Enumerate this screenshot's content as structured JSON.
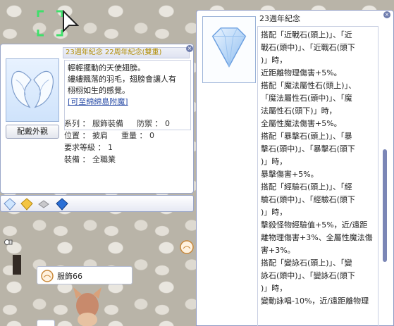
{
  "left_window": {
    "title": "23週年紀念 22周年紀念(雙重)",
    "description": [
      "輕輕擺動的天使翅膀。",
      "縷縷飄落的羽毛，翅膀會讓人有",
      "栩栩如生的感覺。"
    ],
    "enchant_link": "[可至綿綿島附魔]",
    "equip_button": "配戴外觀",
    "properties": [
      {
        "label": "系列",
        "value": "服飾裝備",
        "extra_label": "防禦",
        "extra_value": "0"
      },
      {
        "label": "位置",
        "value": "披肩",
        "extra_label": "重量",
        "extra_value": "0"
      },
      {
        "label": "要求等級",
        "value": "1"
      },
      {
        "label": "裝備",
        "value": "全職業"
      }
    ]
  },
  "right_window": {
    "title": "23週年紀念",
    "lines": [
      "搭配「近戰石(頭上)」、「近",
      "戰石(頭中)」、「近戰石(頭下",
      ")」時，",
      "近距離物理傷害+5%。",
      "搭配「魔法屬性石(頭上)」、",
      "「魔法屬性石(頭中)」、「魔",
      "法屬性石(頭下)」時，",
      "全屬性魔法傷害+5%。",
      "搭配「暴擊石(頭上)」、「暴",
      "擊石(頭中)」、「暴擊石(頭下",
      ")」時，",
      "暴擊傷害+5%。",
      "搭配「經驗石(頭上)」、「經",
      "驗石(頭中)」、「經驗石(頭下",
      ")」時，",
      "擊殺怪物經驗值+5%，近/遠距",
      "離物理傷害+3%、全屬性魔法傷",
      "害+3%。",
      "搭配「變詠石(頭上)」、「變",
      "詠石(頭中)」、「變詠石(頭下",
      ")」時，",
      "變動詠唱-10%，近/遠距離物理"
    ]
  },
  "item_label": {
    "text": "服飾66"
  },
  "icons": [
    "cursor-arrow-icon",
    "angel-wings-icon",
    "diamond-gem-icon",
    "close-icon",
    "slot-gems-icon",
    "chat-icon",
    "buddy-icon"
  ],
  "colors": {
    "title_gold": "#b08b00",
    "link_blue": "#2d4fa8",
    "border": "#9aa6c8",
    "scroll_thumb": "#7b86b6"
  }
}
